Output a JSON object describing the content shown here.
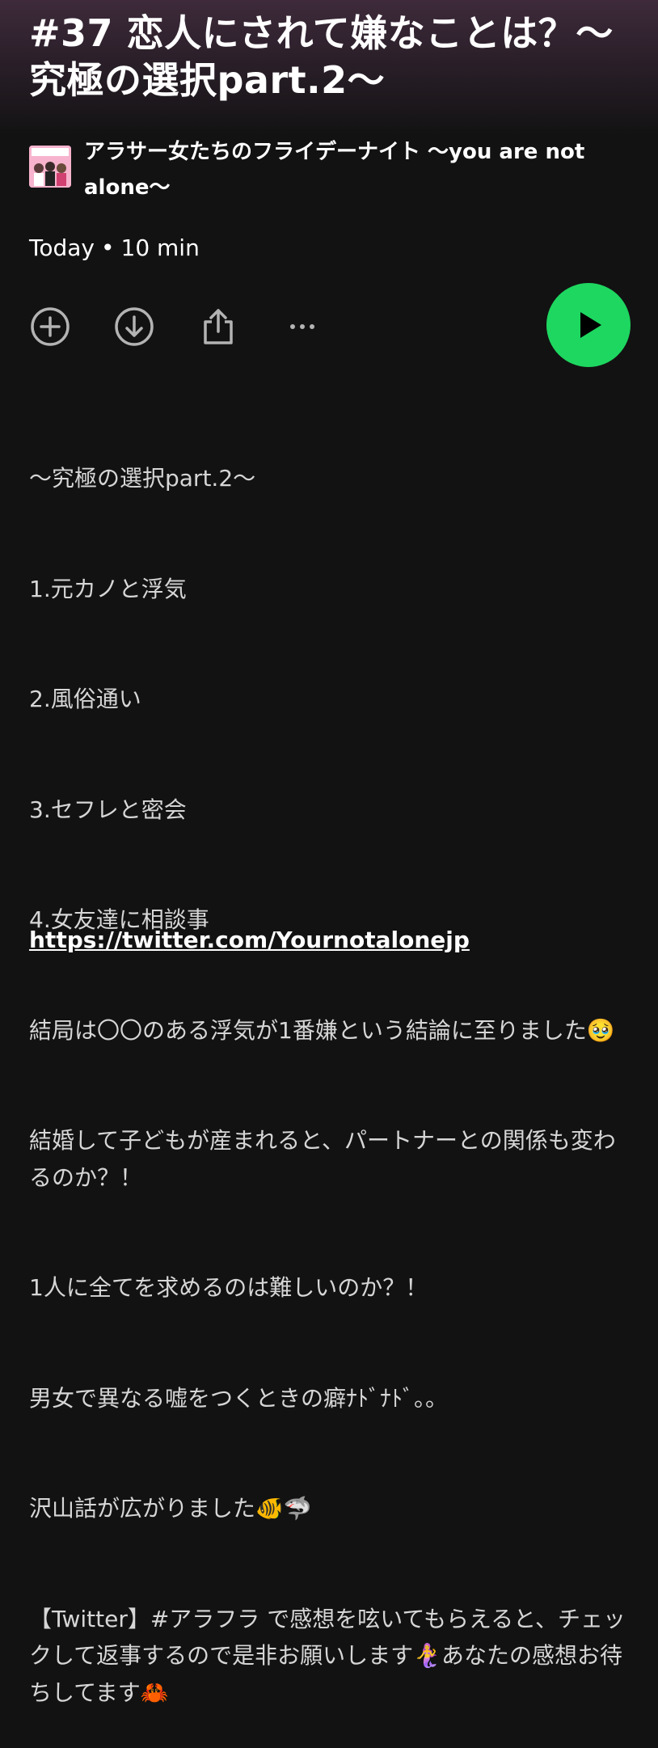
{
  "episode": {
    "title": "#37 恋人にされて嫌なことは？〜究極の選択part.2〜",
    "show_name": "アラサー女たちのフライデーナイト 〜you are not alone〜",
    "date": "Today",
    "separator": "•",
    "duration": "10 min",
    "cover_text": "アラサー女たちのフライデーナイト"
  },
  "actions": {
    "add_icon": "plus-circle-icon",
    "download_icon": "download-circle-icon",
    "share_icon": "share-icon",
    "more_label": "···",
    "play_icon": "play-icon"
  },
  "colors": {
    "background": "#121212",
    "play": "#1ed760",
    "header_tint": "#3e2a3a"
  },
  "description": {
    "lines": [
      "〜究極の選択part.2〜",
      "1.元カノと浮気",
      "2.風俗通い",
      "3.セフレと密会",
      "4.女友達に相談事",
      "結局は〇〇のある浮気が1番嫌という結論に至りました🥹",
      "結婚して子どもが産まれると、パートナーとの関係も変わるのか？！",
      "1人に全てを求めるのは難しいのか？！",
      "男女で異なる嘘をつくときの癖ﾅﾄﾞﾅﾄﾞ。。",
      "沢山話が広がりました🐠🦈",
      "【Twitter】#アラフラ で感想を呟いてもらえると、チェックして返事するので是非お願いします🧜‍♀️あなたの感想お待ちしてます🦀"
    ],
    "link": "https://twitter.com/Yournotalonejp"
  }
}
